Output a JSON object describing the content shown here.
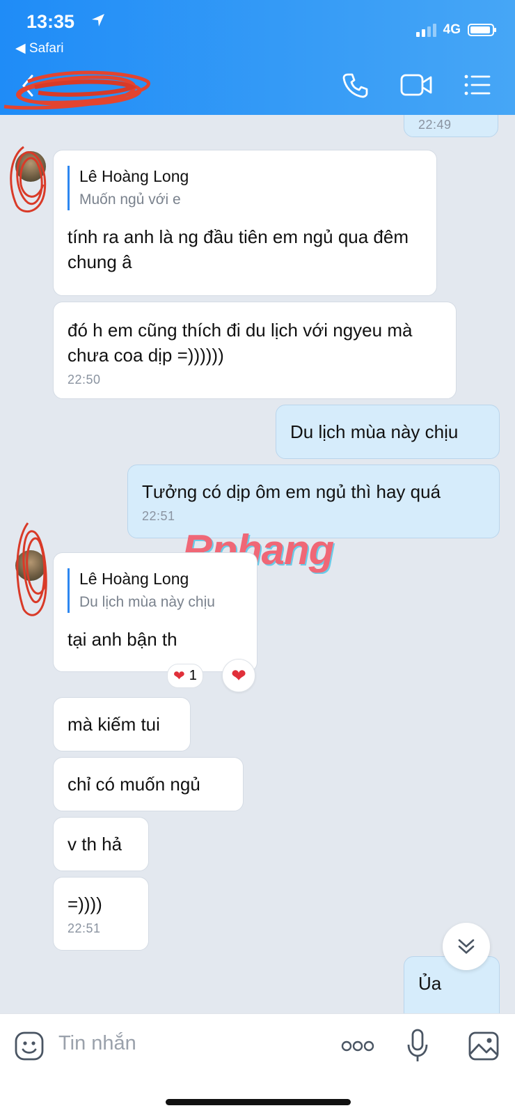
{
  "status_bar": {
    "time": "13:35",
    "back_app": "Safari",
    "network": "4G",
    "battery_level": 0.82
  },
  "header": {
    "contact_name": "",
    "icons": [
      "back-icon",
      "phone-icon",
      "video-icon",
      "menu-icon"
    ]
  },
  "messages": [
    {
      "dir": "out",
      "time": "22:49"
    },
    {
      "dir": "in",
      "quote_name": "Lê Hoàng Long",
      "quote_text": "Muốn ngủ với e",
      "text": "tính ra anh là ng đầu tiên em ngủ qua đêm chung â"
    },
    {
      "dir": "in",
      "text": "đó h em cũng thích đi du lịch với ngyeu mà chưa coa dịp =))))))",
      "time": "22:50"
    },
    {
      "dir": "out",
      "text": "Du lịch mùa này chịu"
    },
    {
      "dir": "out",
      "text": "Tưởng có dịp ôm em ngủ thì hay quá",
      "time": "22:51"
    },
    {
      "dir": "in",
      "quote_name": "Lê Hoàng Long",
      "quote_text": "Du lịch mùa này chịu",
      "text": "tại anh bận th",
      "reaction_count": "1"
    },
    {
      "dir": "in",
      "text": "mà kiếm tui"
    },
    {
      "dir": "in",
      "text": "chỉ có muốn ngủ"
    },
    {
      "dir": "in",
      "text": "v th hả"
    },
    {
      "dir": "in",
      "text": "=))))",
      "time": "22:51"
    },
    {
      "dir": "out",
      "text": "Ủa"
    }
  ],
  "watermark": "Rphang",
  "input": {
    "placeholder": "Tin nhắn"
  },
  "colors": {
    "header": "#2b95f7",
    "incoming": "#ffffff",
    "outgoing": "#d6ecfb",
    "quote_bar": "#2d87f0"
  }
}
